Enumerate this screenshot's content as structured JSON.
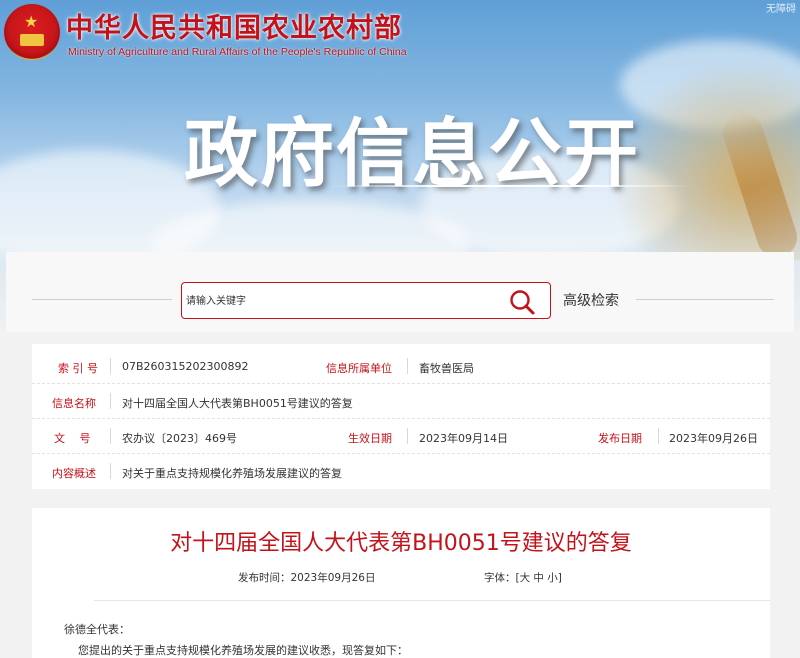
{
  "header": {
    "ministry_cn": "中华人民共和国农业农村部",
    "ministry_en": "Ministry of Agriculture  and  Rural Affairs  of  the People's Republic of China",
    "topright": "无障碍",
    "banner_title": "政府信息公开"
  },
  "search": {
    "placeholder": "请输入关键字",
    "advanced_label": "高级检索"
  },
  "info": {
    "index_label": "索 引 号",
    "index_value": "07B260315202300892",
    "dept_label": "信息所属单位",
    "dept_value": "畜牧兽医局",
    "name_label": "信息名称",
    "name_value": "对十四届全国人大代表第BH0051号建议的答复",
    "doc_label": "文　 号",
    "doc_value": "农办议〔2023〕469号",
    "effective_label": "生效日期",
    "effective_value": "2023年09月14日",
    "publish_label": "发布日期",
    "publish_value": "2023年09月26日",
    "summary_label": "内容概述",
    "summary_value": "对关于重点支持规模化养殖场发展建议的答复"
  },
  "article": {
    "title": "对十四届全国人大代表第BH0051号建议的答复",
    "publish_time": "发布时间：2023年09月26日",
    "font_size_label": "字体：[大 中 小]",
    "salutation": "徐德全代表：",
    "first_line": "您提出的关于重点支持规模化养殖场发展的建议收悉，现答复如下："
  },
  "colors": {
    "brand_red": "#c4121a"
  }
}
